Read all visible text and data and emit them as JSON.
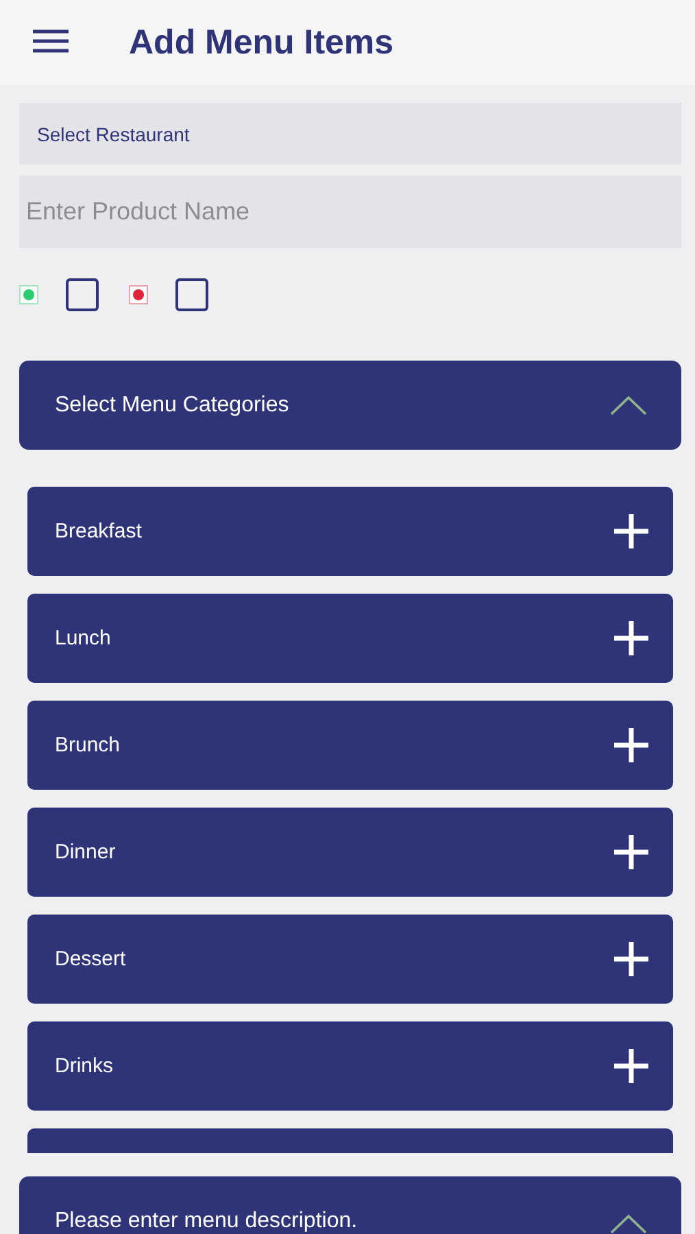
{
  "header": {
    "title": "Add Menu Items"
  },
  "restaurant_select": {
    "label": "Select Restaurant"
  },
  "product_name": {
    "placeholder": "Enter Product Name"
  },
  "food_types": [
    {
      "color": "#2ecc71",
      "checked": false
    },
    {
      "color": "#e0223a",
      "checked": false
    }
  ],
  "categories": {
    "title": "Select Menu Categories",
    "expanded": true,
    "items": [
      {
        "label": "Breakfast"
      },
      {
        "label": "Lunch"
      },
      {
        "label": "Brunch"
      },
      {
        "label": "Dinner"
      },
      {
        "label": "Dessert"
      },
      {
        "label": "Drinks"
      }
    ]
  },
  "description": {
    "title": "Please enter menu description.",
    "expanded": true
  }
}
